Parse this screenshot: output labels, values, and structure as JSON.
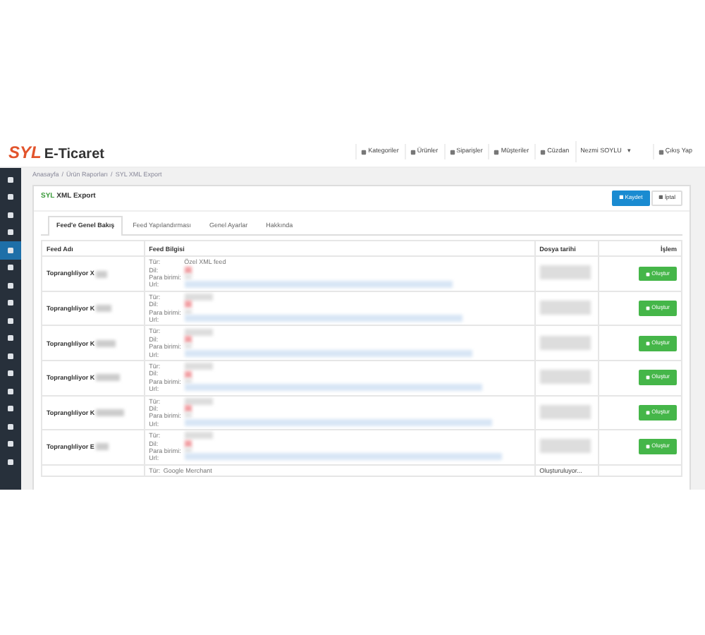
{
  "header": {
    "logo": {
      "brand": "SYL",
      "name": "E-Ticaret"
    },
    "nav": [
      "Kategoriler",
      "Ürünler",
      "Siparişler",
      "Müşteriler",
      "Cüzdan"
    ],
    "user": "Nezmi SOYLU",
    "user_caret": "▾",
    "logout": "Çıkış Yap"
  },
  "sidebar": {
    "items": [
      {
        "selected": false
      },
      {
        "selected": false
      },
      {
        "selected": false
      },
      {
        "selected": false
      },
      {
        "selected": true
      },
      {
        "selected": false
      },
      {
        "selected": false
      },
      {
        "selected": false
      },
      {
        "selected": false
      },
      {
        "selected": false
      },
      {
        "selected": false
      },
      {
        "selected": false
      },
      {
        "selected": false
      },
      {
        "selected": false
      },
      {
        "selected": false
      },
      {
        "selected": false
      },
      {
        "selected": false
      }
    ]
  },
  "breadcrumb": [
    "Anasayfa",
    "Ürün Raporları",
    "SYL XML Export"
  ],
  "breadcrumb_separator": "/",
  "panel": {
    "title_brand": "SYL",
    "title": "XML Export",
    "buttons": [
      {
        "label": "Kaydet",
        "kind": "primary"
      },
      {
        "label": "İptal",
        "kind": "plain"
      }
    ]
  },
  "tabs": [
    {
      "label": "Feed'e Genel Bakış",
      "selected": true
    },
    {
      "label": "Feed Yapılandırması",
      "selected": false
    },
    {
      "label": "Genel Ayarlar",
      "selected": false
    },
    {
      "label": "Hakkında",
      "selected": false
    }
  ],
  "table": {
    "columns": [
      "Feed Adı",
      "Feed Bilgisi",
      "Dosya tarihi",
      "İşlem"
    ],
    "rows": [
      {
        "name": "Topranglıliyor X",
        "labels": [
          "Tür:",
          "Dil:",
          "Para birimi:",
          "Url:"
        ],
        "type_value": "Özel XML feed",
        "action": "Oluştur"
      },
      {
        "name": "Topranglıliyor K",
        "labels": [
          "Tür:",
          "Dil:",
          "Para birimi:",
          "Url:"
        ],
        "action": "Oluştur"
      },
      {
        "name": "Topranglıliyor K",
        "labels": [
          "Tür:",
          "Dil:",
          "Para birimi:",
          "Url:"
        ],
        "action": "Oluştur"
      },
      {
        "name": "Topranglıliyor K",
        "labels": [
          "Tür:",
          "Dil:",
          "Para birimi:",
          "Url:"
        ],
        "action": "Oluştur"
      },
      {
        "name": "Topranglıliyor K",
        "labels": [
          "Tür:",
          "Dil:",
          "Para birimi:",
          "Url:"
        ],
        "action": "Oluştur"
      },
      {
        "name": "Topranglıliyor E",
        "labels": [
          "Tür:",
          "Dil:",
          "Para birimi:",
          "Url:"
        ],
        "action": "Oluştur"
      },
      {
        "labels": [
          "Tür:"
        ],
        "type_value": "Google Merchant",
        "date": "Oluşturuluyor..."
      }
    ]
  }
}
